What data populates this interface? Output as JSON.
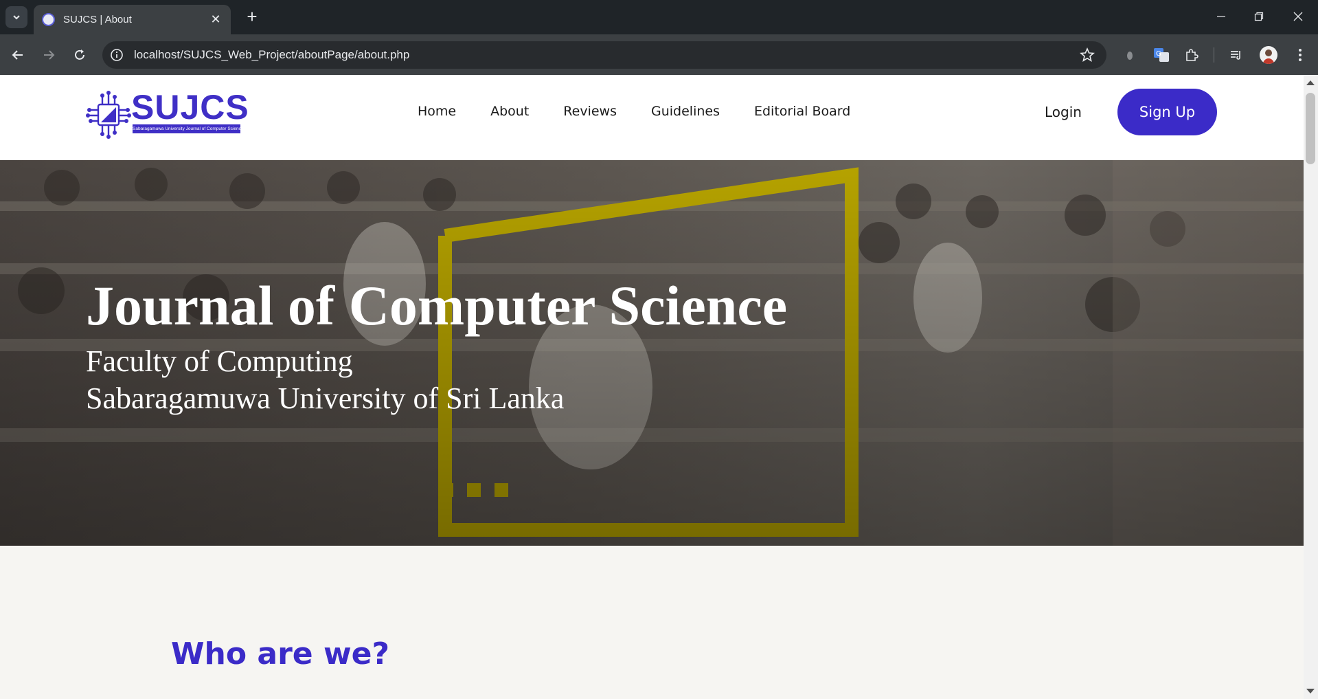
{
  "browser": {
    "tab_title": "SUJCS | About",
    "url": "localhost/SUJCS_Web_Project/aboutPage/about.php"
  },
  "header": {
    "logo_text": "SUJCS",
    "logo_subtitle": "Sabaragamuwa University Journal of Computer Science",
    "nav": [
      "Home",
      "About",
      "Reviews",
      "Guidelines",
      "Editorial Board"
    ],
    "login_label": "Login",
    "signup_label": "Sign Up"
  },
  "hero": {
    "title": "Journal of Computer Science",
    "line1": "Faculty of Computing",
    "line2": "Sabaragamuwa University of Sri Lanka"
  },
  "section": {
    "heading": "Who are we?"
  },
  "colors": {
    "brand": "#3b2bc8",
    "frame": "#c9b400",
    "chrome_dark": "#1f2428",
    "chrome_toolbar": "#3c4043"
  },
  "icons": [
    "tab-search-icon",
    "close-icon",
    "plus-icon",
    "minimize-icon",
    "restore-icon",
    "back-icon",
    "forward-icon",
    "reload-icon",
    "info-icon",
    "star-icon",
    "extension-icon",
    "translate-icon",
    "puzzle-icon",
    "media-icon",
    "menu-icon"
  ]
}
